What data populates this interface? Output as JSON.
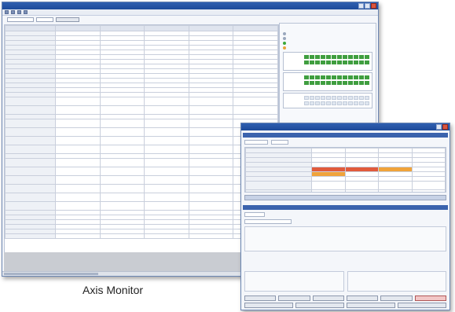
{
  "caption": "Axis Monitor",
  "colors": {
    "title_bar": "#2f5fb0",
    "status_on": "#3aa83a",
    "status_warn": "#e8a43a",
    "bit_on": "#3f9e3f",
    "highlight_red": "#e15b3c",
    "highlight_orange": "#f0a33a",
    "active_button": "#f2c7c7"
  },
  "icons": [
    "save-icon",
    "open-icon",
    "print-icon",
    "minimize-icon",
    "maximize-icon",
    "close-icon"
  ],
  "axis_monitor": {
    "title": "",
    "filter_title": "",
    "column_headers": [
      "",
      "",
      "",
      "",
      "",
      ""
    ],
    "row_labels": [
      "",
      "",
      "",
      "",
      "",
      "",
      "",
      "",
      "",
      "",
      "",
      "",
      "",
      "",
      "",
      "",
      "",
      "",
      "",
      "",
      "",
      "",
      "",
      "",
      "",
      "",
      "",
      "",
      "",
      "",
      "",
      "",
      "",
      ""
    ]
  },
  "module_info": {
    "title": "",
    "items": [
      "",
      "",
      "",
      ""
    ]
  },
  "positioning_test": {
    "title": "",
    "buttons": [
      "",
      "",
      "",
      "",
      "",
      ""
    ]
  }
}
